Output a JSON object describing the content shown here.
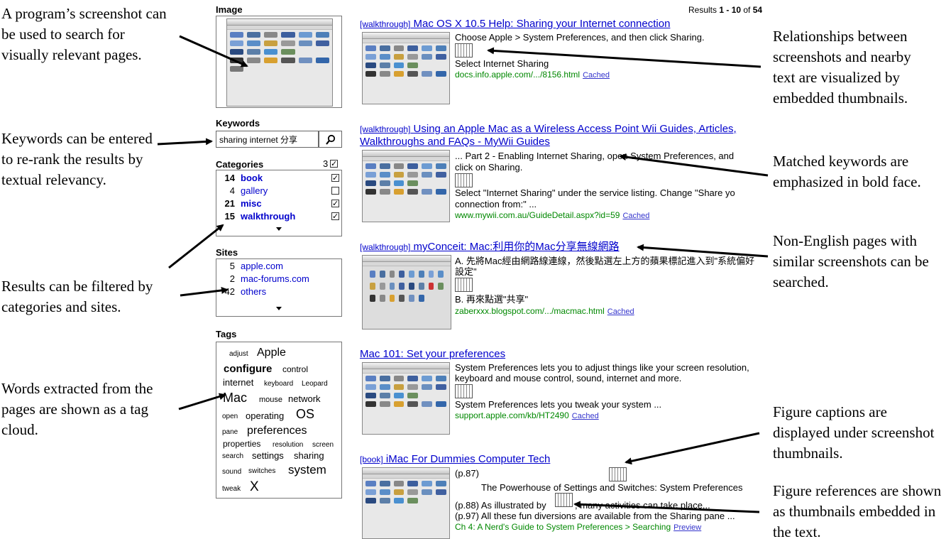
{
  "annotations": {
    "left": [
      "A program’s screenshot can be used to search for visually relevant pages.",
      "Keywords can be entered to re-rank the results by textual relevancy.",
      "Results can be filtered by categories and sites.",
      "Words extracted from the pages are shown as a tag cloud."
    ],
    "right": [
      "Relationships between screenshots and nearby text are visualized by embedded thumbnails.",
      "Matched keywords are emphasized in bold face.",
      "Non-English pages with similar screenshots can be searched.",
      "Figure captions are displayed under screenshot thumbnails.",
      "Figure references are shown as thumbnails embedded in the text."
    ]
  },
  "sidebar": {
    "image_heading": "Image",
    "keywords_heading": "Keywords",
    "keywords_value": "sharing internet 分享",
    "search_icon": "magnifier-icon",
    "categories_heading": "Categories",
    "categories_count": "3",
    "categories": [
      {
        "count": "14",
        "label": "book",
        "checked": true,
        "bold": true
      },
      {
        "count": "4",
        "label": "gallery",
        "checked": false,
        "bold": false
      },
      {
        "count": "21",
        "label": "misc",
        "checked": true,
        "bold": true
      },
      {
        "count": "15",
        "label": "walkthrough",
        "checked": true,
        "bold": true
      }
    ],
    "sites_heading": "Sites",
    "sites": [
      {
        "count": "5",
        "label": "apple.com"
      },
      {
        "count": "2",
        "label": "mac-forums.com"
      },
      {
        "count": "42",
        "label": "others"
      }
    ],
    "tags_heading": "Tags",
    "tags": [
      "adjust",
      "Apple",
      "configure",
      "control",
      "internet",
      "keyboard",
      "Leopard",
      "Mac",
      "mouse",
      "network",
      "open",
      "operating",
      "OS",
      "pane",
      "preferences",
      "properties",
      "resolution",
      "screen",
      "search",
      "settings",
      "sharing",
      "sound",
      "switches",
      "system",
      "tweak",
      "X"
    ]
  },
  "results_header": {
    "prefix": "Results ",
    "range": "1 - 10",
    "of": " of ",
    "total": "54"
  },
  "results": [
    {
      "category": "[walkthrough]",
      "title": "Mac OS X 10.5 Help: Sharing your Internet connection",
      "snippet1": "Choose Apple > System Preferences, and then click Sharing.",
      "snippet2": "Select Internet Sharing",
      "url": "docs.info.apple.com/.../8156.html",
      "cached": "Cached"
    },
    {
      "category": "[walkthrough]",
      "title_line1": "Using an Apple Mac as a Wireless Access Point Wii Guides, Articles,",
      "title_line2": "Walkthroughs and FAQs - MyWii Guides",
      "snippet1": "... Part 2 - Enabling Internet Sharing, open System Preferences, and",
      "snippet1b": "click on Sharing.",
      "snippet2": "Select \"Internet Sharing\" under the service listing. Change \"Share yo",
      "snippet2b": "connection from:\" ...",
      "url": "www.mywii.com.au/GuideDetail.aspx?id=59",
      "cached": "Cached"
    },
    {
      "category": "[walkthrough]",
      "title": "myConceit: Mac:利用你的Mac分享無線網路",
      "snippet1": "A. 先將Mac經由網路線連線，然後點選左上方的蘋果標記進入到\"系統偏好",
      "snippet1b": "設定\"",
      "snippet2": "B. 再來點選\"共享\"",
      "url": "zaberxxx.blogspot.com/.../macmac.html",
      "cached": "Cached"
    },
    {
      "title": "Mac 101: Set your preferences",
      "snippet1": "System Preferences lets you to adjust things like your screen resolution,",
      "snippet1b": "keyboard and mouse control, sound, internet and more.",
      "snippet2": "System Preferences lets you tweak your system ...",
      "url": "support.apple.com/kb/HT2490",
      "cached": "Cached"
    },
    {
      "category": "[book]",
      "title": "iMac For Dummies Computer Tech",
      "page1": "(p.87)",
      "caption": "The Powerhouse of Settings and Switches: System Preferences",
      "ref1": "(p.88) As illustrated by",
      "ref1b": ", many activities can take place...",
      "ref2": "(p.97) All these fun diversions are available from the Sharing pane ...",
      "url": "Ch 4: A Nerd's Guide to System Preferences > Searching",
      "preview": "Preview"
    }
  ]
}
